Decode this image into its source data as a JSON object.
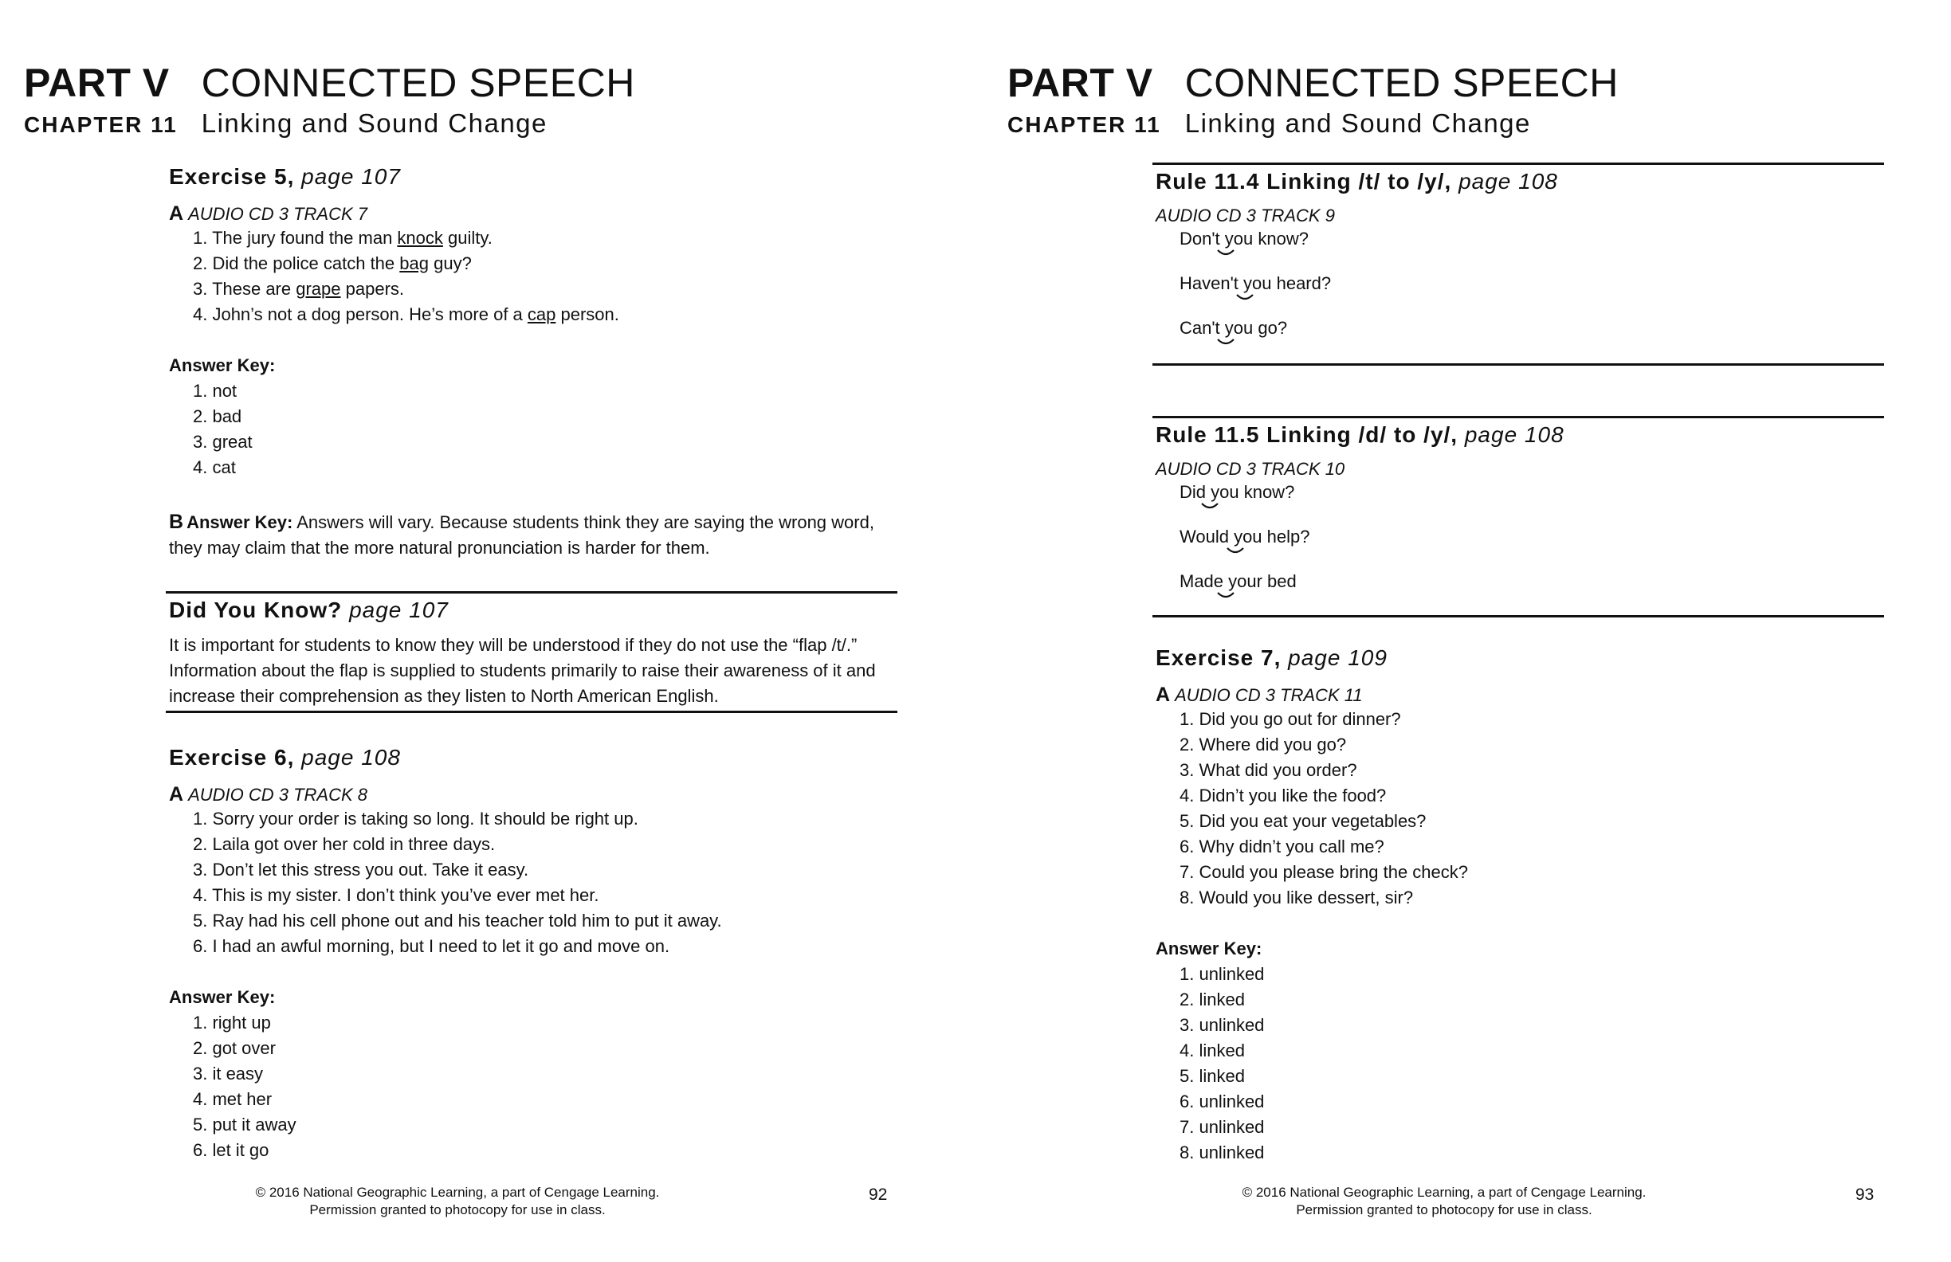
{
  "left": {
    "part_label": "PART V",
    "part_title": "CONNECTED SPEECH",
    "chapter_label": "CHAPTER 11",
    "chapter_title": "Linking and Sound Change",
    "ex5": {
      "heading": "Exercise 5,",
      "page": "page 107",
      "a_letter": "A",
      "a_track": "AUDIO CD 3 TRACK 7",
      "items": [
        {
          "pre": "1. The jury found the man ",
          "u": "knock",
          "post": " guilty."
        },
        {
          "pre": "2. Did the police catch the ",
          "u": "bag",
          "post": " guy?"
        },
        {
          "pre": "3. These are ",
          "u": "grape",
          "post": " papers."
        },
        {
          "pre": "4. John’s not a dog person. He’s more of a ",
          "u": "cap",
          "post": " person."
        }
      ],
      "key_label": "Answer Key:",
      "key": [
        "1. not",
        "2. bad",
        "3. great",
        "4. cat"
      ],
      "b_letter": "B",
      "b_key_label": "Answer Key:",
      "b_text": " Answers will vary. Because students think they are saying the wrong word, they may claim that the more natural pronunciation is harder for them."
    },
    "dyk": {
      "heading": "Did You Know?",
      "page": "page 107",
      "text": "It is important for students to know they will be understood if they do not use the “flap /t/.”  Information about the flap is supplied to students primarily to raise their awareness of it and increase their comprehension as they listen to North American English."
    },
    "ex6": {
      "heading": "Exercise 6,",
      "page": "page 108",
      "a_letter": "A",
      "a_track": "AUDIO CD 3 TRACK 8",
      "items": [
        "1. Sorry your order is taking so long. It should be right up.",
        "2. Laila got over her cold in three days.",
        "3. Don’t let this stress you out. Take it easy.",
        "4. This is my sister. I don’t think you’ve ever met her.",
        "5. Ray had his cell phone out and his teacher told him to put it away.",
        "6. I had an awful morning, but I need to let it go and move on."
      ],
      "key_label": "Answer Key:",
      "key": [
        "1. right up",
        "2. got over",
        "3. it easy",
        "4. met her",
        "5. put it away",
        "6. let it go"
      ]
    },
    "footer_line1": "© 2016 National Geographic Learning, a part of Cengage Learning.",
    "footer_line2": "Permission granted to photocopy for use in class.",
    "page_number": "92"
  },
  "right": {
    "part_label": "PART V",
    "part_title": "CONNECTED SPEECH",
    "chapter_label": "CHAPTER 11",
    "chapter_title": "Linking and Sound Change",
    "rule114": {
      "heading": "Rule 11.4 Linking /t/ to /y/,",
      "page": "page 108",
      "track": "AUDIO CD 3 TRACK 9",
      "items": [
        "Don't you know?",
        "Haven't you heard?",
        "Can't you go?"
      ]
    },
    "rule115": {
      "heading": "Rule 11.5 Linking /d/ to /y/,",
      "page": "page 108",
      "track": "AUDIO CD 3 TRACK 10",
      "items": [
        "Did you know?",
        "Would you help?",
        "Made your bed"
      ]
    },
    "ex7": {
      "heading": "Exercise 7,",
      "page": "page 109",
      "a_letter": "A",
      "a_track": "AUDIO CD 3 TRACK 11",
      "items": [
        "1. Did you go out for dinner?",
        "2. Where did you go?",
        "3. What did you order?",
        "4. Didn’t you like the food?",
        "5. Did you eat your vegetables?",
        "6. Why didn’t you call me?",
        "7. Could you please bring the check?",
        "8. Would you like dessert, sir?"
      ],
      "key_label": "Answer Key:",
      "key": [
        "1. unlinked",
        "2. linked",
        "3. unlinked",
        "4. linked",
        "5. linked",
        "6. unlinked",
        "7. unlinked",
        "8. unlinked"
      ]
    },
    "footer_line1": "© 2016 National Geographic Learning, a part of Cengage Learning.",
    "footer_line2": "Permission granted to photocopy for use in class.",
    "page_number": "93"
  }
}
